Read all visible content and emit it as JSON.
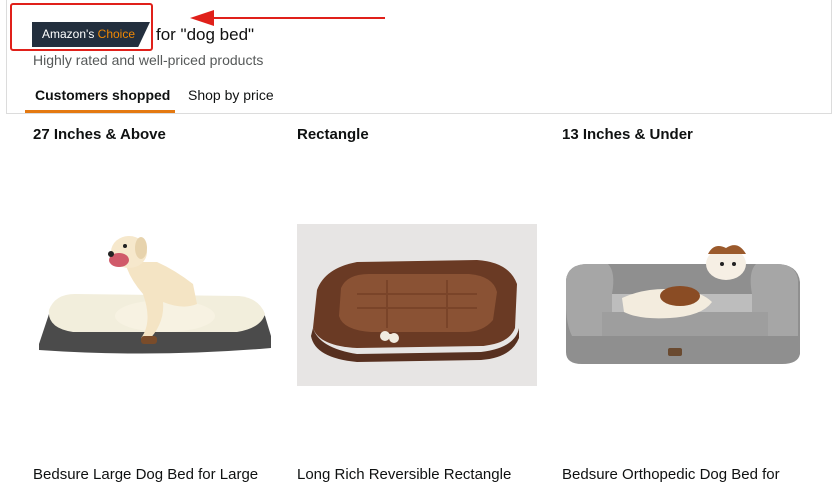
{
  "badge": {
    "prefix": "Amazon's",
    "accent": "Choice"
  },
  "query_text": "for \"dog bed\"",
  "subtitle": "Highly rated and well-priced products",
  "tabs": [
    {
      "label": "Customers shopped",
      "active": true
    },
    {
      "label": "Shop by price",
      "active": false
    }
  ],
  "products": [
    {
      "heading": "27 Inches & Above",
      "title": "Bedsure Large Dog Bed for Large"
    },
    {
      "heading": "Rectangle",
      "title": "Long Rich Reversible Rectangle"
    },
    {
      "heading": "13 Inches & Under",
      "title": "Bedsure Orthopedic Dog Bed for"
    }
  ],
  "colors": {
    "accent": "#e47911",
    "badge_bg": "#232f3e",
    "annotation": "#e0201a"
  }
}
